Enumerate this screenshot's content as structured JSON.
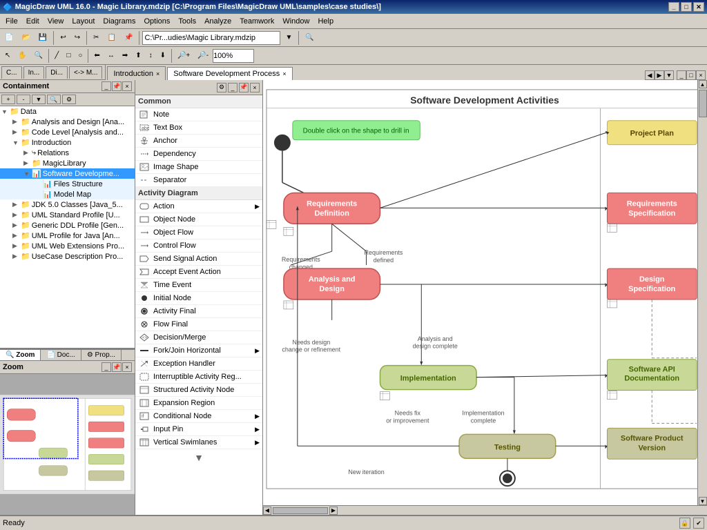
{
  "app": {
    "title": "MagicDraw UML 16.0 - Magic Library.mdzip [C:\\Program Files\\MagicDraw UML\\samples\\case studies\\]",
    "status": "Ready"
  },
  "menubar": {
    "items": [
      "File",
      "Edit",
      "View",
      "Layout",
      "Diagrams",
      "Options",
      "Tools",
      "Analyze",
      "Teamwork",
      "Window",
      "Help"
    ]
  },
  "toolbar": {
    "path_label": "C:\\Pr...udies\\Magic Library.mdzip"
  },
  "tabs": [
    {
      "label": "Introduction",
      "active": false
    },
    {
      "label": "Software Development Process",
      "active": true
    }
  ],
  "breadcrumbs": [
    "C...",
    "In...",
    "Di...",
    "<-> M..."
  ],
  "containment": {
    "title": "Containment",
    "tree": [
      {
        "id": "data",
        "label": "Data",
        "level": 0,
        "expanded": true,
        "icon": "folder"
      },
      {
        "id": "analysis",
        "label": "Analysis and Design [Ana...",
        "level": 1,
        "icon": "folder"
      },
      {
        "id": "code",
        "label": "Code Level [Analysis and...",
        "level": 1,
        "icon": "folder"
      },
      {
        "id": "intro",
        "label": "Introduction",
        "level": 1,
        "expanded": true,
        "icon": "folder"
      },
      {
        "id": "relations",
        "label": "Relations",
        "level": 2,
        "icon": "relations"
      },
      {
        "id": "magiclibrary",
        "label": "MagicLibrary",
        "level": 2,
        "icon": "folder"
      },
      {
        "id": "softwareddev",
        "label": "Software Developme...",
        "level": 2,
        "icon": "diagram",
        "selected": true
      },
      {
        "id": "filesstructure",
        "label": "Files Structure",
        "level": 3,
        "icon": "diagram"
      },
      {
        "id": "modelmap",
        "label": "Model Map",
        "level": 3,
        "icon": "diagram"
      },
      {
        "id": "jdk",
        "label": "JDK 5.0 Classes [Java_5...",
        "level": 1,
        "icon": "folder"
      },
      {
        "id": "umlstd",
        "label": "UML Standard Profile [U...",
        "level": 1,
        "icon": "folder"
      },
      {
        "id": "genericddl",
        "label": "Generic DDL Profile [Gen...",
        "level": 1,
        "icon": "folder"
      },
      {
        "id": "umlprofile",
        "label": "UML Profile for Java [An...",
        "level": 1,
        "icon": "folder"
      },
      {
        "id": "umlweb",
        "label": "UML Web Extensions Pro...",
        "level": 1,
        "icon": "folder"
      },
      {
        "id": "usecase",
        "label": "UseCase Description Pro...",
        "level": 1,
        "icon": "folder"
      }
    ]
  },
  "bottom_tabs": [
    "Zoom",
    "Doc...",
    "Prop..."
  ],
  "zoom_panel": {
    "title": "Zoom"
  },
  "elements": {
    "categories": [
      {
        "name": "Common",
        "items": [
          {
            "label": "Note",
            "icon": "note",
            "has_arrow": false
          },
          {
            "label": "Text Box",
            "icon": "textbox",
            "has_arrow": false
          },
          {
            "label": "Anchor",
            "icon": "anchor",
            "has_arrow": false
          },
          {
            "label": "Dependency",
            "icon": "dependency",
            "has_arrow": false
          },
          {
            "label": "Image Shape",
            "icon": "image",
            "has_arrow": false
          },
          {
            "label": "Separator",
            "icon": "sep",
            "has_arrow": false
          }
        ]
      },
      {
        "name": "Activity Diagram",
        "items": [
          {
            "label": "Action",
            "icon": "action",
            "has_arrow": true
          },
          {
            "label": "Object Node",
            "icon": "objectnode",
            "has_arrow": false
          },
          {
            "label": "Object Flow",
            "icon": "objectflow",
            "has_arrow": false
          },
          {
            "label": "Control Flow",
            "icon": "controlflow",
            "has_arrow": false
          },
          {
            "label": "Send Signal Action",
            "icon": "sendsignal",
            "has_arrow": false
          },
          {
            "label": "Accept Event Action",
            "icon": "acceptevent",
            "has_arrow": false
          },
          {
            "label": "Time Event",
            "icon": "timeevent",
            "has_arrow": false
          },
          {
            "label": "Initial Node",
            "icon": "initialnode",
            "has_arrow": false
          },
          {
            "label": "Activity Final",
            "icon": "activityfinal",
            "has_arrow": false
          },
          {
            "label": "Flow Final",
            "icon": "flowfinal",
            "has_arrow": false
          },
          {
            "label": "Decision/Merge",
            "icon": "decision",
            "has_arrow": false
          },
          {
            "label": "Fork/Join Horizontal",
            "icon": "forkjoin",
            "has_arrow": true
          },
          {
            "label": "Exception Handler",
            "icon": "exception",
            "has_arrow": false
          },
          {
            "label": "Interruptible Activity Reg...",
            "icon": "interruptible",
            "has_arrow": false
          },
          {
            "label": "Structured Activity Node",
            "icon": "structured",
            "has_arrow": false
          },
          {
            "label": "Expansion Region",
            "icon": "expansion",
            "has_arrow": false
          },
          {
            "label": "Conditional Node",
            "icon": "conditional",
            "has_arrow": true
          },
          {
            "label": "Input Pin",
            "icon": "inputpin",
            "has_arrow": true
          },
          {
            "label": "Vertical Swimlanes",
            "icon": "swimlanes",
            "has_arrow": true
          }
        ]
      }
    ]
  },
  "diagram": {
    "title": "Software Development Activities",
    "zoom": "100%",
    "nodes": [
      {
        "id": "start",
        "type": "initial",
        "label": ""
      },
      {
        "id": "requirements",
        "type": "action",
        "label": "Requirements\nDefinition",
        "color": "#f08080"
      },
      {
        "id": "analysis",
        "type": "action",
        "label": "Analysis and\nDesign",
        "color": "#f08080"
      },
      {
        "id": "implementation",
        "type": "action",
        "label": "Implementation",
        "color": "#c8d896"
      },
      {
        "id": "testing",
        "type": "action",
        "label": "Testing",
        "color": "#c8c8a0"
      },
      {
        "id": "project_plan",
        "type": "output",
        "label": "Project Plan",
        "color": "#f0e080"
      },
      {
        "id": "requirements_spec",
        "type": "output",
        "label": "Requirements\nSpecification",
        "color": "#f08080"
      },
      {
        "id": "design_spec",
        "type": "output",
        "label": "Design\nSpecification",
        "color": "#f08080"
      },
      {
        "id": "software_api",
        "type": "output",
        "label": "Software API\nDocumentation",
        "color": "#c8d896"
      },
      {
        "id": "software_product",
        "type": "output",
        "label": "Software Product\nVersion",
        "color": "#c8c8a0"
      },
      {
        "id": "end",
        "type": "final",
        "label": ""
      }
    ],
    "tooltip": "Double click on the shape to drill in"
  }
}
